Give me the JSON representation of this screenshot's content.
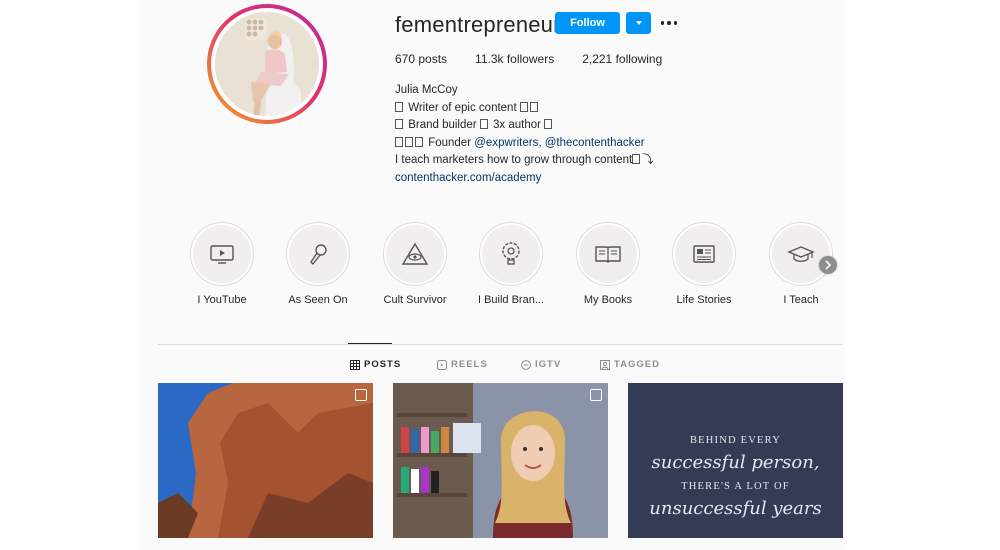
{
  "profile": {
    "username": "fementrepreneur",
    "follow_label": "Follow",
    "stats": {
      "posts": "670 posts",
      "followers": "11.3k followers",
      "following": "2,221 following"
    },
    "bio": {
      "name": "Julia McCoy",
      "line1": "Writer of epic content",
      "line2a": "Brand builder",
      "line2b": "3x author",
      "line3_prefix": "Founder",
      "line3_link1": "@expwriters,",
      "line3_link2": "@thecontenthacker",
      "line4": "I teach marketers how to grow through content",
      "website": "contenthacker.com/academy"
    }
  },
  "highlights": [
    {
      "label": "I YouTube",
      "icon": "video-icon"
    },
    {
      "label": "As Seen On",
      "icon": "microphone-icon"
    },
    {
      "label": "Cult Survivor",
      "icon": "eye-triangle-icon"
    },
    {
      "label": "I Build Bran...",
      "icon": "gear-lightbulb-icon"
    },
    {
      "label": "My Books",
      "icon": "book-icon"
    },
    {
      "label": "Life Stories",
      "icon": "newspaper-icon"
    },
    {
      "label": "I Teach",
      "icon": "graduation-cap-icon"
    }
  ],
  "tabs": {
    "posts": "POSTS",
    "reels": "REELS",
    "igtv": "IGTV",
    "tagged": "TAGGED"
  },
  "posts": {
    "post3": {
      "line1": "BEHIND EVERY",
      "line2": "successful person,",
      "line3": "THERE'S A LOT OF",
      "line4": "unsuccessful years"
    }
  },
  "colors": {
    "follow_blue": "#0095f6",
    "link": "#00376b"
  }
}
